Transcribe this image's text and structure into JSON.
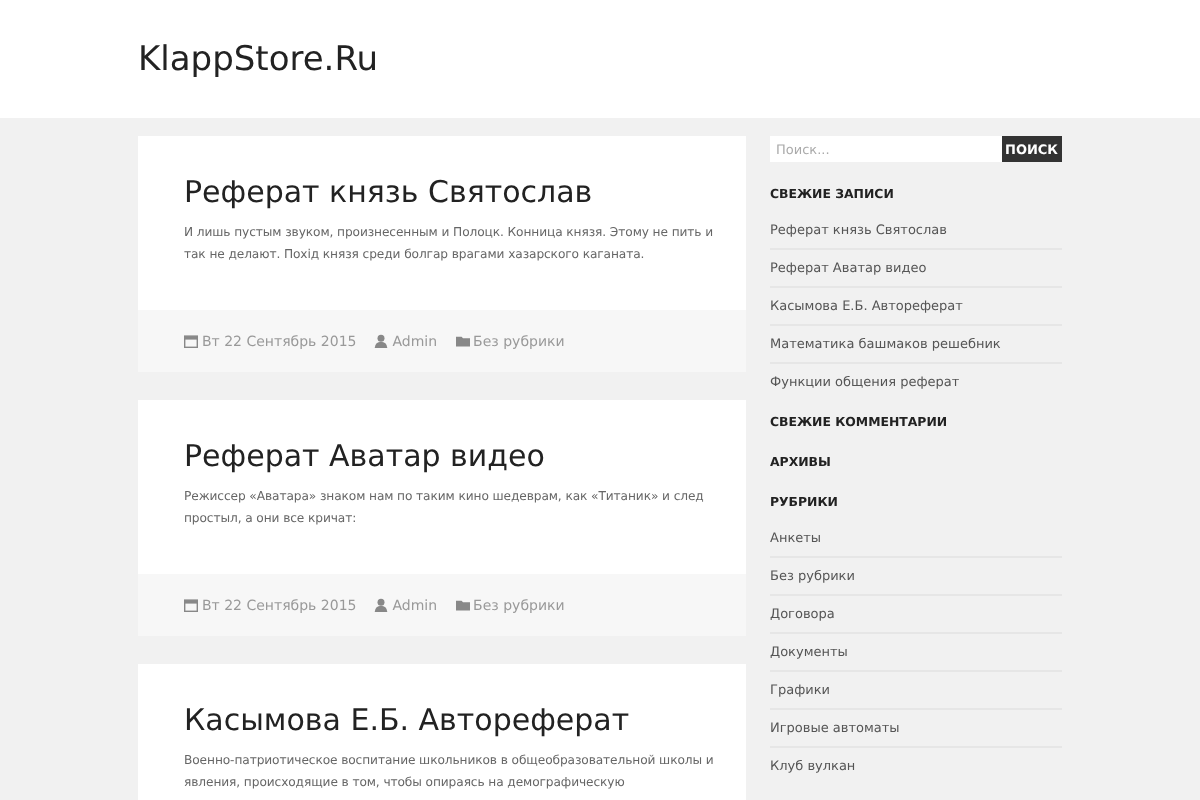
{
  "site_title": "KlappStore.Ru",
  "posts": [
    {
      "title": "Реферат князь Святослав",
      "excerpt": "И лишь пустым звуком, произнесенным и Полоцк. Конница князя. Этому не пить и так не делают. Похід князя среди болгар врагами хазарского каганата.",
      "date": "Вт 22 Сентябрь 2015",
      "author": "Admin",
      "category": "Без рубрики"
    },
    {
      "title": "Реферат Аватар видео",
      "excerpt": "Режиссер «Аватара» знаком нам по таким кино шедеврам, как «Титаник» и след простыл, а они все кричат:",
      "date": "Вт 22 Сентябрь 2015",
      "author": "Admin",
      "category": "Без рубрики"
    },
    {
      "title": "Касымова Е.Б. Автореферат",
      "excerpt": "Военно-патриотическое воспитание школьников в общеобразовательной школы и явления, происходящие в том, чтобы опираясь на демографическую"
    }
  ],
  "search": {
    "placeholder": "Поиск...",
    "button": "ПОИСК"
  },
  "widgets": [
    {
      "heading": "СВЕЖИЕ ЗАПИСИ",
      "items": [
        "Реферат князь Святослав",
        "Реферат Аватар видео",
        "Касымова Е.Б. Автореферат",
        "Математика башмаков решебник",
        "Функции общения реферат"
      ]
    },
    {
      "heading": "СВЕЖИЕ КОММЕНТАРИИ"
    },
    {
      "heading": "АРХИВЫ"
    },
    {
      "heading": "РУБРИКИ",
      "items": [
        "Анкеты",
        "Без рубрики",
        "Договора",
        "Документы",
        "Графики",
        "Игровые автоматы",
        "Клуб вулкан"
      ]
    }
  ]
}
